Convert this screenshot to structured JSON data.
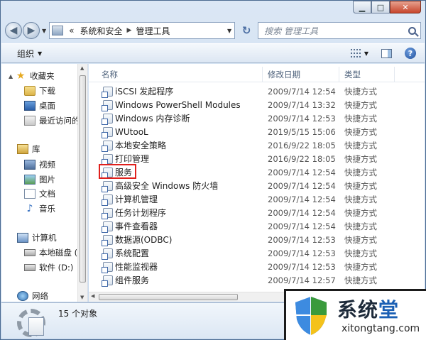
{
  "window": {
    "caption_buttons": {
      "minimize": "▁",
      "maximize": "□",
      "close": "✕"
    }
  },
  "address_bar": {
    "prefix": "«",
    "breadcrumbs": [
      "系统和安全",
      "管理工具"
    ],
    "search_placeholder": "搜索 管理工具"
  },
  "command_bar": {
    "organize_label": "组织"
  },
  "nav_pane": {
    "items": [
      {
        "label": "收藏夹",
        "icon": "star-icon"
      },
      {
        "label": "下载",
        "icon": "download-folder-icon"
      },
      {
        "label": "桌面",
        "icon": "desktop-icon"
      },
      {
        "label": "最近访问的",
        "icon": "recent-places-icon"
      },
      {
        "label": "库",
        "icon": "library-icon"
      },
      {
        "label": "视频",
        "icon": "video-library-icon"
      },
      {
        "label": "图片",
        "icon": "pictures-library-icon"
      },
      {
        "label": "文档",
        "icon": "documents-library-icon"
      },
      {
        "label": "音乐",
        "icon": "music-library-icon"
      },
      {
        "label": "计算机",
        "icon": "computer-icon"
      },
      {
        "label": "本地磁盘 (C",
        "icon": "local-disk-icon"
      },
      {
        "label": "软件 (D:)",
        "icon": "drive-icon"
      },
      {
        "label": "网络",
        "icon": "network-icon"
      }
    ]
  },
  "file_list": {
    "columns": {
      "name": "名称",
      "date": "修改日期",
      "type": "类型"
    },
    "rows": [
      {
        "name": "iSCSI 发起程序",
        "date": "2009/7/14 12:54",
        "type": "快捷方式"
      },
      {
        "name": "Windows PowerShell Modules",
        "date": "2009/7/14 13:32",
        "type": "快捷方式"
      },
      {
        "name": "Windows 内存诊断",
        "date": "2009/7/14 12:53",
        "type": "快捷方式"
      },
      {
        "name": "WUtooL",
        "date": "2019/5/15 15:06",
        "type": "快捷方式"
      },
      {
        "name": "本地安全策略",
        "date": "2016/9/22 18:05",
        "type": "快捷方式"
      },
      {
        "name": "打印管理",
        "date": "2016/9/22 18:05",
        "type": "快捷方式"
      },
      {
        "name": "服务",
        "date": "2009/7/14 12:54",
        "type": "快捷方式"
      },
      {
        "name": "高级安全 Windows 防火墙",
        "date": "2009/7/14 12:54",
        "type": "快捷方式"
      },
      {
        "name": "计算机管理",
        "date": "2009/7/14 12:54",
        "type": "快捷方式"
      },
      {
        "name": "任务计划程序",
        "date": "2009/7/14 12:54",
        "type": "快捷方式"
      },
      {
        "name": "事件查看器",
        "date": "2009/7/14 12:54",
        "type": "快捷方式"
      },
      {
        "name": "数据源(ODBC)",
        "date": "2009/7/14 12:53",
        "type": "快捷方式"
      },
      {
        "name": "系统配置",
        "date": "2009/7/14 12:53",
        "type": "快捷方式"
      },
      {
        "name": "性能监视器",
        "date": "2009/7/14 12:53",
        "type": "快捷方式"
      },
      {
        "name": "组件服务",
        "date": "2009/7/14 12:57",
        "type": "快捷方式"
      }
    ],
    "highlighted_item": "服务"
  },
  "details_pane": {
    "count_text": "15 个对象"
  },
  "watermark": {
    "title_main": "系统",
    "title_accent": "堂",
    "url": "xitongtang.com"
  },
  "colors": {
    "highlight": "#e0201c",
    "brand_blue": "#1a5fb4",
    "window_frame": "#c3d6ec"
  }
}
